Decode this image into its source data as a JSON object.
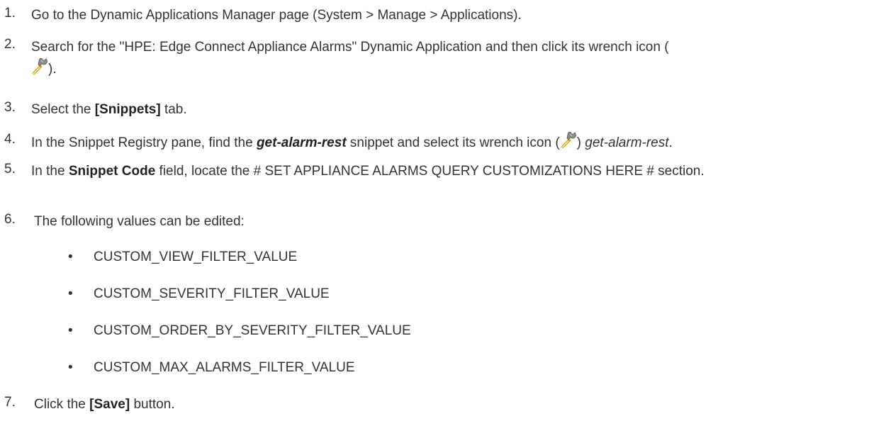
{
  "steps": [
    {
      "number": "1.",
      "text": "Go to the Dynamic Applications Manager page (System > Manage > Applications)."
    },
    {
      "number": "2.",
      "text_before": "Search for the \"HPE: Edge Connect Appliance Alarms\" Dynamic Application and then click its wrench icon (",
      "text_after": ")."
    },
    {
      "number": "3.",
      "pre": "Select the ",
      "bold": "[Snippets]",
      "post": " tab."
    },
    {
      "number": "4.",
      "pre": "In the Snippet Registry pane, find the ",
      "bold_italic": "get-alarm-rest",
      "mid": " snippet and select its wrench icon (",
      "after_icon": ") ",
      "italic": "get-alarm-rest",
      "post": "."
    },
    {
      "number": "5.",
      "pre": "In the ",
      "bold": "Snippet Code",
      "post": " field, locate the # SET APPLIANCE ALARMS QUERY CUSTOMIZATIONS HERE # section."
    },
    {
      "number": "6.",
      "text": "The following values can be edited:",
      "bullets": [
        "CUSTOM_VIEW_FILTER_VALUE",
        "CUSTOM_SEVERITY_FILTER_VALUE",
        "CUSTOM_ORDER_BY_SEVERITY_FILTER_VALUE",
        "CUSTOM_MAX_ALARMS_FILTER_VALUE"
      ],
      "bullet_char": "•"
    },
    {
      "number": "7.",
      "pre": "Click the ",
      "bold": "[Save]",
      "post": " button."
    }
  ],
  "icons": {
    "wrench": "wrench-icon"
  },
  "colors": {
    "text": "#333333",
    "wrench_body": "#f2b705",
    "wrench_head": "#8c8c8c"
  }
}
